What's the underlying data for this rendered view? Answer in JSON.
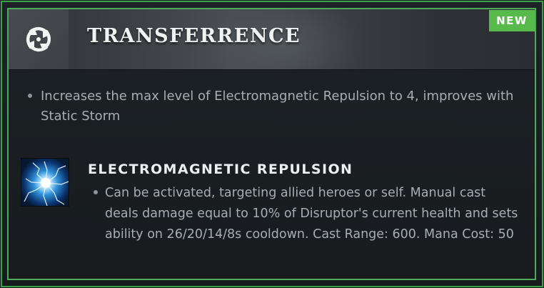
{
  "facet": {
    "icon": "swirl-arrows-icon",
    "title": "TRANSFERRENCE",
    "badge": "NEW",
    "description": "Increases the max level of Electromagnetic Repulsion to 4, improves with Static Storm"
  },
  "ability": {
    "icon": "electromagnetic-repulsion-icon",
    "title": "ELECTROMAGNETIC REPULSION",
    "description": "Can be activated, targeting allied heroes or self. Manual cast deals damage equal to 10% of Disruptor's current health and sets ability on 26/20/14/8s cooldown. Cast Range: 600. Mana Cost: 50"
  },
  "colors": {
    "border_green": "#4ea95a",
    "badge_green": "#57ba4a",
    "text_primary": "#f1f1f1",
    "text_secondary": "#a6adb3"
  }
}
